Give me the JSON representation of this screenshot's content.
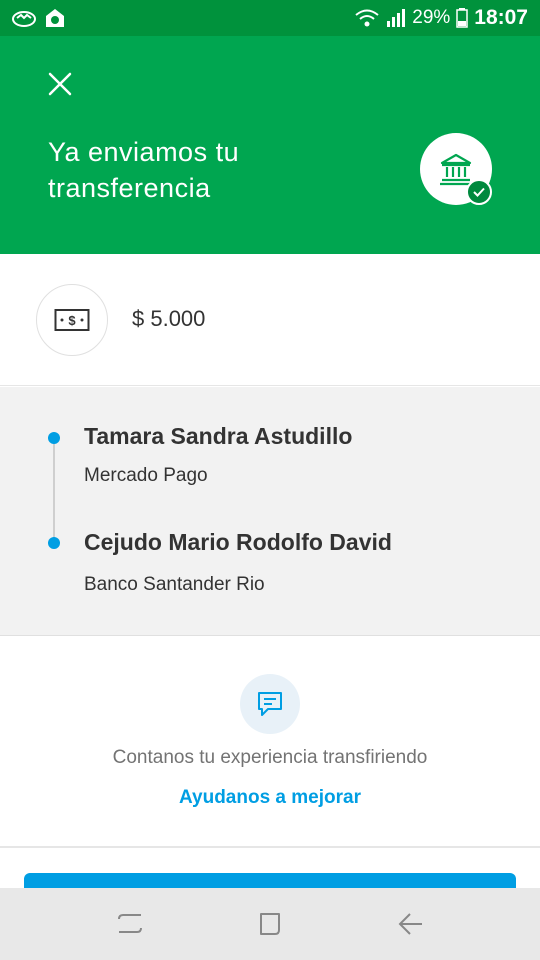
{
  "status_bar": {
    "battery": "29%",
    "time": "18:07",
    "icons": [
      "mercado-app-icon",
      "notification-app-icon",
      "wifi-icon",
      "signal-icon",
      "battery-icon"
    ]
  },
  "header": {
    "title": "Ya enviamos tu transferencia",
    "close_icon": "close-icon",
    "badge_icon": "bank-icon",
    "check_icon": "check-icon",
    "colors": {
      "background": "#00a650",
      "status_bar": "#00923c"
    }
  },
  "amount": {
    "icon": "money-bill-icon",
    "value": "$ 5.000"
  },
  "route": {
    "from": {
      "name": "Tamara Sandra Astudillo",
      "bank": "Mercado Pago"
    },
    "to": {
      "name": "Cejudo Mario Rodolfo David",
      "bank": "Banco Santander Rio"
    },
    "dot_color": "#009ee3"
  },
  "feedback": {
    "icon": "chat-message-icon",
    "text": "Contanos tu experiencia transfiriendo",
    "link": "Ayudanos a mejorar",
    "link_color": "#009ee3"
  },
  "nav_bar": {
    "buttons": [
      "recent-apps-icon",
      "home-icon",
      "back-icon"
    ]
  }
}
